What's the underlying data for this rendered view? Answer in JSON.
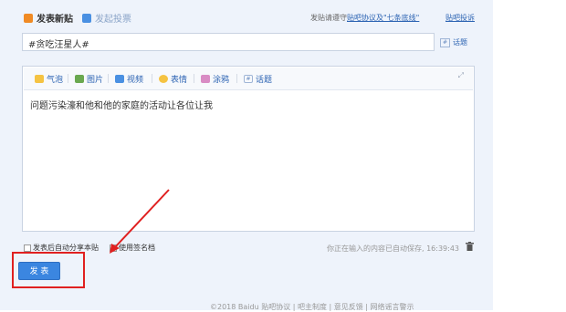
{
  "tabs": {
    "new_post": "发表新贴",
    "vote": "发起投票"
  },
  "notice": {
    "prefix": "发贴请遵守",
    "rules_link": "贴吧协议及\"七条底线\"",
    "complain_link": "贴吧投诉"
  },
  "title_input": {
    "value": "#贪吃汪星人#"
  },
  "topic_label": "话题",
  "toolbar": {
    "bubble": "气泡",
    "image": "图片",
    "video": "视频",
    "emoji": "表情",
    "graffiti": "涂鸦",
    "topic": "话题"
  },
  "editor": {
    "content": "问题污染濠和他和他的家庭的活动让各位让我"
  },
  "options": {
    "share_label": "发表后自动分享本贴",
    "signature_label": "使用签名档"
  },
  "autosave": "你正在输入的内容已自动保存, 16:39:43",
  "post_button": "发 表",
  "footer": "©2018 Baidu  贴吧协议  |  吧主制度  |  意见反馈  |  网络谣言警示",
  "colors": {
    "accent": "#3b86e0",
    "link": "#2d64b3",
    "panel_bg": "#eef3fb",
    "annotation": "#e02020"
  }
}
